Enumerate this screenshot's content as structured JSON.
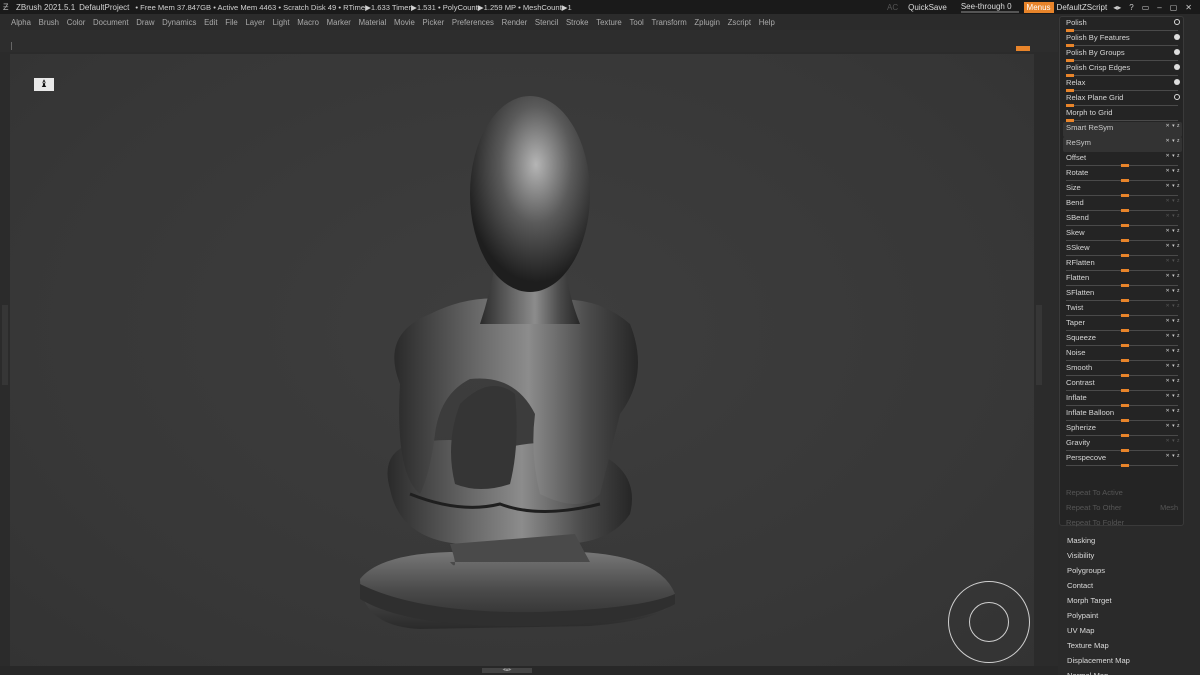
{
  "titlebar": {
    "app": "ZBrush 2021.5.1",
    "project": "DefaultProject",
    "stats": "• Free Mem 37.847GB • Active Mem 4463 • Scratch Disk 49 •  RTime▶1.633 Timer▶1.531 • PolyCount▶1.259 MP  • MeshCount▶1",
    "ac": "AC",
    "quicksave": "QuickSave",
    "see_through": "See-through  0",
    "menus": "Menus",
    "script": "DefaultZScript",
    "window_icons": [
      "◂▸",
      "?",
      "▭",
      "–",
      "▢",
      "✕"
    ]
  },
  "menubar": [
    "Alpha",
    "Brush",
    "Color",
    "Document",
    "Draw",
    "Dynamics",
    "Edit",
    "File",
    "Layer",
    "Light",
    "Macro",
    "Marker",
    "Material",
    "Movie",
    "Picker",
    "Preferences",
    "Render",
    "Stencil",
    "Stroke",
    "Texture",
    "Tool",
    "Transform",
    "Zplugin",
    "Zscript",
    "Help"
  ],
  "deformation": {
    "rows": [
      {
        "label": "Polish",
        "kind": "dot-ring"
      },
      {
        "label": "Polish By Features",
        "kind": "dot"
      },
      {
        "label": "Polish By Groups",
        "kind": "dot"
      },
      {
        "label": "Polish Crisp Edges",
        "kind": "dot"
      },
      {
        "label": "Relax",
        "kind": "dot"
      },
      {
        "label": "Relax Plane Grid",
        "kind": "dot-ring"
      },
      {
        "label": "Morph to Grid",
        "kind": "none"
      },
      {
        "label": "Smart ReSym",
        "kind": "btn"
      },
      {
        "label": "ReSym",
        "kind": "btn"
      },
      {
        "label": "Offset",
        "kind": "slider"
      },
      {
        "label": "Rotate",
        "kind": "slider"
      },
      {
        "label": "Size",
        "kind": "slider"
      },
      {
        "label": "Bend",
        "kind": "slider-dim"
      },
      {
        "label": "SBend",
        "kind": "slider-dim"
      },
      {
        "label": "Skew",
        "kind": "slider"
      },
      {
        "label": "SSkew",
        "kind": "slider"
      },
      {
        "label": "RFlatten",
        "kind": "slider-dim"
      },
      {
        "label": "Flatten",
        "kind": "slider"
      },
      {
        "label": "SFlatten",
        "kind": "slider"
      },
      {
        "label": "Twist",
        "kind": "slider-dim"
      },
      {
        "label": "Taper",
        "kind": "slider"
      },
      {
        "label": "Squeeze",
        "kind": "slider"
      },
      {
        "label": "Noise",
        "kind": "slider"
      },
      {
        "label": "Smooth",
        "kind": "slider"
      },
      {
        "label": "Contrast",
        "kind": "slider"
      },
      {
        "label": "Inflate",
        "kind": "slider"
      },
      {
        "label": "Inflate Balloon",
        "kind": "slider"
      },
      {
        "label": "Spherize",
        "kind": "slider"
      },
      {
        "label": "Gravity",
        "kind": "slider-dim"
      },
      {
        "label": "Perspecove",
        "kind": "slider"
      }
    ],
    "repeat_active": "Repeat To Active",
    "repeat_other": "Repeat To Other",
    "mesh": "Mesh",
    "repeat_folder": "Repeat To Folder"
  },
  "subpalettes": [
    "Masking",
    "Visibility",
    "Polygroups",
    "Contact",
    "Morph Target",
    "Polypaint",
    "UV Map",
    "Texture Map",
    "Displacement Map",
    "Normal Map"
  ],
  "colors": {
    "accent": "#e8842a",
    "panel": "#2a2a2a",
    "canvas": "#3a3a3a"
  }
}
